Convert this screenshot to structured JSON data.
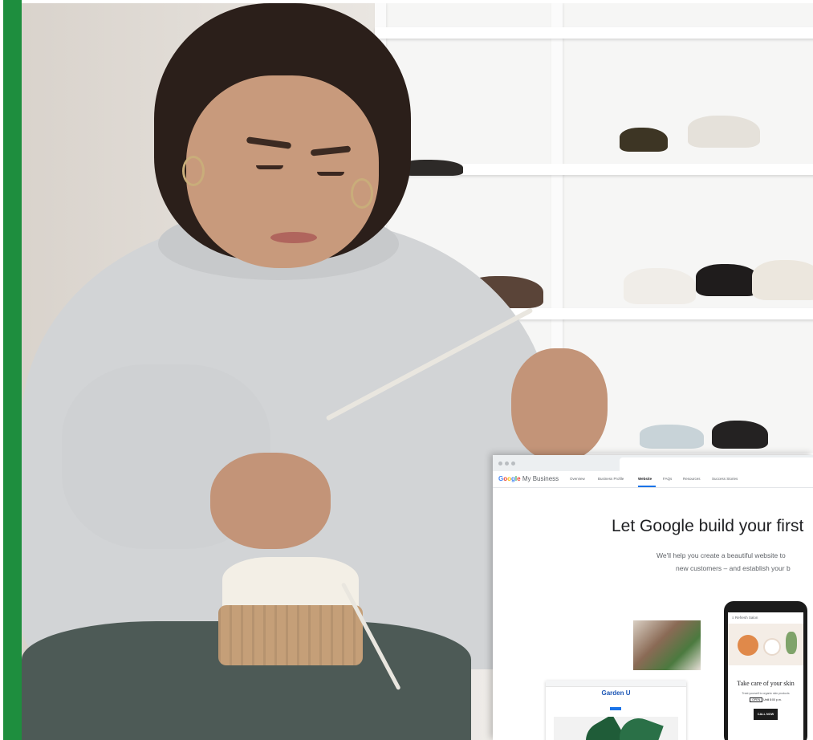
{
  "colors": {
    "accent_bar": "#1e8e3e",
    "nav_active_underline": "#1a73e8",
    "headline_text": "#202124",
    "body_text": "#5f6368"
  },
  "browser": {
    "brand_google": "Google",
    "brand_product": "My Business",
    "nav": [
      {
        "label": "Overview",
        "active": false
      },
      {
        "label": "Business Profile",
        "active": false
      },
      {
        "label": "Website",
        "active": true
      },
      {
        "label": "FAQs",
        "active": false
      },
      {
        "label": "Resources",
        "active": false
      },
      {
        "label": "Success Stories",
        "active": false
      }
    ],
    "headline": "Let Google build your first",
    "sub_line1": "We'll help you create a beautiful website to",
    "sub_line2": "new customers – and establish your b"
  },
  "mini_site": {
    "title": "Garden U"
  },
  "phone": {
    "header": "Refresh Salon",
    "title": "Take care of your skin",
    "subtitle": "Treat yourself to organic skin products",
    "open_label": "OPEN",
    "hours": "Until 8:00 p.m.",
    "call_label": "CALL NOW",
    "menu_icon": "hamburger-menu-icon"
  }
}
